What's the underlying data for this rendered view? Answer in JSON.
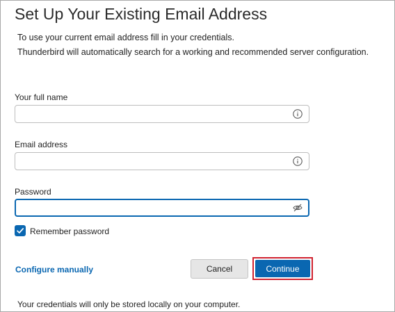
{
  "header": {
    "title": "Set Up Your Existing Email Address",
    "description_line1": "To use your current email address fill in your credentials.",
    "description_line2": "Thunderbird will automatically search for a working and recommended server configuration."
  },
  "form": {
    "full_name": {
      "label": "Your full name",
      "value": "",
      "placeholder": "",
      "icon": "info-icon"
    },
    "email": {
      "label": "Email address",
      "value": "",
      "placeholder": "",
      "icon": "info-icon"
    },
    "password": {
      "label": "Password",
      "value": "",
      "placeholder": "",
      "icon": "eye-hidden-icon",
      "focused": true
    },
    "remember_password": {
      "label": "Remember password",
      "checked": true
    }
  },
  "actions": {
    "configure_manually": "Configure manually",
    "cancel": "Cancel",
    "continue": "Continue"
  },
  "footer": {
    "note": "Your credentials will only be stored locally on your computer."
  },
  "colors": {
    "accent": "#0a67b1",
    "highlight_border": "#d0222f",
    "button_gray": "#e6e6e6"
  }
}
